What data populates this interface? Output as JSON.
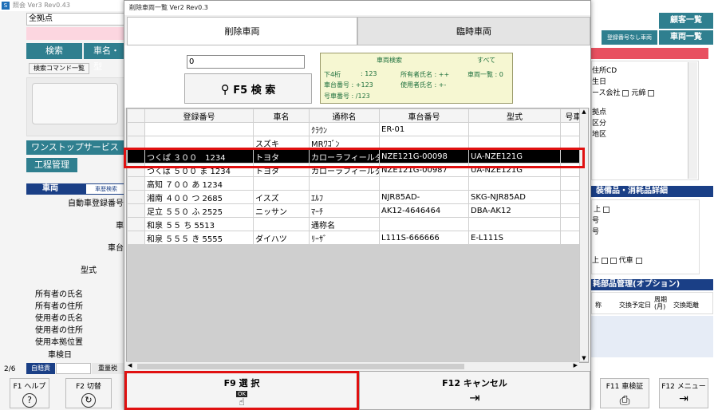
{
  "app": {
    "title": "照会 Ver3 Rev0.43",
    "icon": "S"
  },
  "left": {
    "location_field": "全拠点",
    "search_button": "検索",
    "vehicle_button": "車名・型",
    "search_command_list": "検索コマンド一覧",
    "one_stop": "ワンストップサービス",
    "process_mgmt": "工程管理",
    "vehicle_header": "車両",
    "history_search": "車歴検索",
    "labels": [
      "自動車登録番号",
      "車",
      "車台",
      "型式",
      "所有者の氏名",
      "所有者の住所",
      "使用者の氏名",
      "使用者の住所",
      "使用本拠位置",
      "車検日"
    ],
    "page": "2/6",
    "liability": "自賠責",
    "weight_tax": "重量税"
  },
  "right": {
    "customer_list": "顧客一覧",
    "no_reg_vehicle": "登録番号なし車両",
    "vehicle_list": "車両一覧",
    "fields": [
      "住所CD",
      "生日",
      "ース会社",
      "元締",
      "拠点",
      "区分",
      "地区"
    ],
    "equipment_header": "装備品・消耗品詳細",
    "daisha": "代車",
    "parts_header": "耗部品管理(オプション)",
    "parts_cols": [
      "交換予定日",
      "周期(月)",
      "交換距離"
    ],
    "parts_first_col": "称",
    "misc_labels": [
      "号",
      "号",
      "上"
    ]
  },
  "modal": {
    "title": "削除車両一覧 Ver2 Rev0.3",
    "tabs": {
      "deleted": "削除車両",
      "temporary": "臨時車両"
    },
    "input_value": "0",
    "search_button": "F5 検 索",
    "info": {
      "header_search": "車両検索",
      "header_all": "すべて",
      "row1_left": "下4桁",
      "row1_val": ": 123",
      "row1_owner": "所有者氏名 : ++",
      "row1_all": "車両一覧 : 0",
      "row2_left": "車台番号 : +123",
      "row2_user": "使用者氏名 : +-",
      "row3_left": "号車番号 : /123"
    },
    "columns": [
      "登録番号",
      "車名",
      "通称名",
      "車台番号",
      "型式",
      "号車"
    ],
    "rows": [
      [
        "",
        "",
        "ｸﾗｳﾝ",
        "ER-01",
        ""
      ],
      [
        "",
        "スズキ",
        "MRﾜｺﾞﾝ",
        "",
        ""
      ],
      [
        "つくば ３００　1234",
        "トヨタ",
        "カローラフィールダ",
        "NZE121G-00098",
        "UA-NZE121G"
      ],
      [
        "つくば ５００ ま 1234",
        "トヨタ",
        "カローラフィールダ",
        "NZE121G-00987",
        "UA-NZE121G"
      ],
      [
        "高知 ７００ あ 1234",
        "",
        "",
        "",
        ""
      ],
      [
        "湘南 ４００ つ 2685",
        "イスズ",
        "ｴﾙﾌ",
        "NJR85AD-",
        "SKG-NJR85AD"
      ],
      [
        "足立 ５５０ ふ 2525",
        "ニッサン",
        "ﾏｰﾁ",
        "AK12-4646464",
        "DBA-AK12"
      ],
      [
        "和泉 ５５ ち 5513",
        "",
        "通称名",
        "",
        ""
      ],
      [
        "和泉 ５５５ き 5555",
        "ダイハツ",
        "ﾘｰｻﾞ",
        "L111S-666666",
        "E-L111S"
      ]
    ],
    "selected_row": 2,
    "f9_label": "F9 選 択",
    "f9_sub": "OK",
    "f12_label": "F12 キャンセル"
  },
  "fkeys": {
    "f1": "F1 ヘルプ",
    "f2": "F2 切替",
    "f11": "F11 車検証",
    "f12": "F12 メニュー"
  }
}
